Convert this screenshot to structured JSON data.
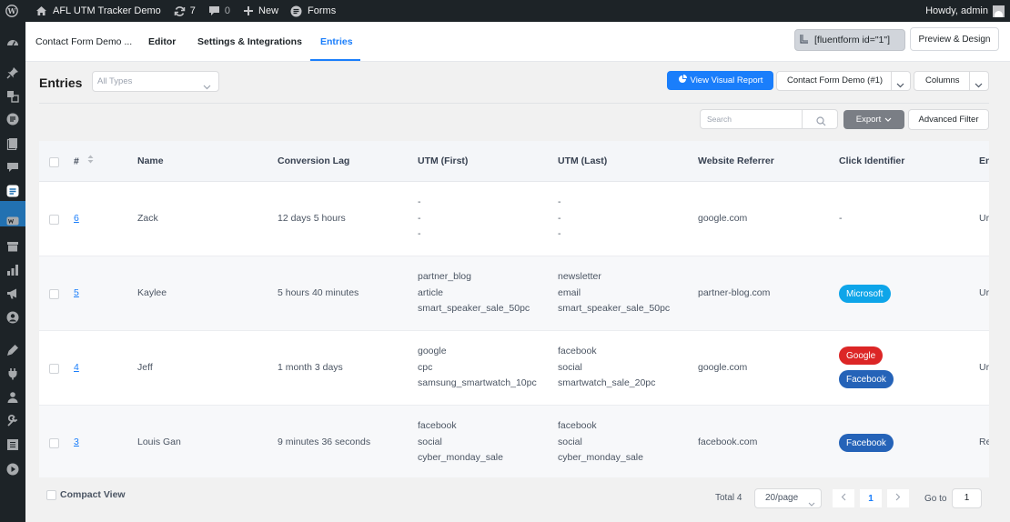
{
  "admin_bar": {
    "site_name": "AFL UTM Tracker Demo",
    "updates_count": "7",
    "comments_count": "0",
    "new_label": "New",
    "forms_label": "Forms",
    "greeting": "Howdy, admin"
  },
  "top_nav": {
    "tabs": [
      {
        "label": "Contact Form Demo ..."
      },
      {
        "label": "Editor"
      },
      {
        "label": "Settings & Integrations"
      },
      {
        "label": "Entries"
      }
    ],
    "shortcode": "[fluentform id=\"1\"]",
    "preview_label": "Preview & Design"
  },
  "entries": {
    "title": "Entries",
    "type_placeholder": "All Types",
    "visual_report_label": "View Visual Report",
    "form_select_value": "Contact Form Demo (#1)",
    "columns_label": "Columns",
    "search_placeholder": "Search",
    "export_label": "Export",
    "advanced_filter_label": "Advanced Filter"
  },
  "table": {
    "headers": [
      "#",
      "Name",
      "Conversion Lag",
      "UTM (First)",
      "UTM (Last)",
      "Website Referrer",
      "Click Identifier",
      "En"
    ],
    "rows": [
      {
        "id": "6",
        "name": "Zack",
        "lag": "12 days 5 hours",
        "utm_first": [
          "-",
          "-",
          "-"
        ],
        "utm_last": [
          "-",
          "-",
          "-"
        ],
        "referrer": "google.com",
        "click_text": "-",
        "clicks": [],
        "extra": "Ur"
      },
      {
        "id": "5",
        "name": "Kaylee",
        "lag": "5 hours 40 minutes",
        "utm_first": [
          "partner_blog",
          "article",
          "smart_speaker_sale_50pc"
        ],
        "utm_last": [
          "newsletter",
          "email",
          "smart_speaker_sale_50pc"
        ],
        "referrer": "partner-blog.com",
        "click_text": "",
        "clicks": [
          "Microsoft"
        ],
        "extra": "Ur"
      },
      {
        "id": "4",
        "name": "Jeff",
        "lag": "1 month 3 days",
        "utm_first": [
          "google",
          "cpc",
          "samsung_smartwatch_10pc"
        ],
        "utm_last": [
          "facebook",
          "social",
          "smartwatch_sale_20pc"
        ],
        "referrer": "google.com",
        "click_text": "",
        "clicks": [
          "Google",
          "Facebook"
        ],
        "extra": "Ur"
      },
      {
        "id": "3",
        "name": "Louis Gan",
        "lag": "9 minutes 36 seconds",
        "utm_first": [
          "facebook",
          "social",
          "cyber_monday_sale"
        ],
        "utm_last": [
          "facebook",
          "social",
          "cyber_monday_sale"
        ],
        "referrer": "facebook.com",
        "click_text": "",
        "clicks": [
          "Facebook"
        ],
        "extra": "Re"
      }
    ]
  },
  "footer": {
    "compact_view_label": "Compact View",
    "total_text": "Total 4",
    "per_page": "20/page",
    "current_page": "1",
    "goto_label": "Go to",
    "goto_value": "1"
  },
  "colors": {
    "accent": "#1a7efb",
    "admin_bar": "#1d2327",
    "microsoft_badge": "#0ea5e9",
    "google_badge": "#dc2626",
    "facebook_badge": "#2563b8",
    "export_button": "#7a7e85"
  },
  "icons": {
    "admin_bar": [
      "wordpress-logo-icon",
      "home-icon",
      "updates-icon",
      "comments-icon",
      "plus-icon",
      "forms-icon",
      "avatar-icon"
    ],
    "sidebar": [
      "dashboard-icon",
      "pin-icon",
      "translate-icon",
      "forms-icon",
      "pages-icon",
      "comments-icon",
      "fluent-forms-icon",
      "woo-icon",
      "archive-icon",
      "analytics-icon",
      "marketing-icon",
      "user-circle-icon",
      "appearance-icon",
      "plugins-icon",
      "users-icon",
      "tools-icon",
      "settings-icon",
      "play-icon"
    ]
  }
}
